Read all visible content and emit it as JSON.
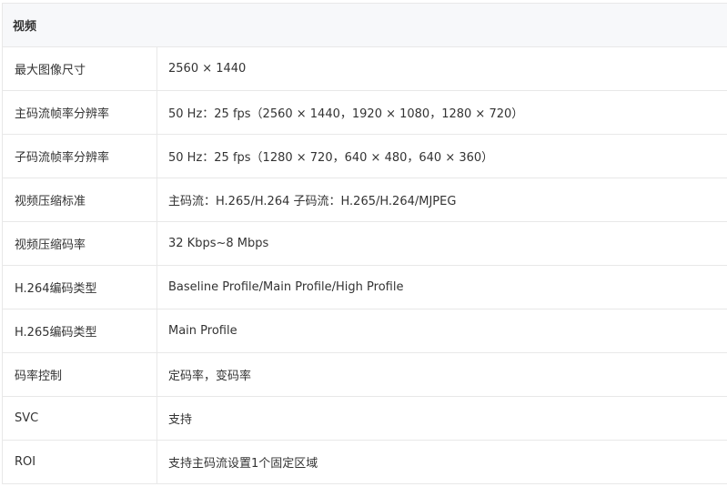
{
  "section": {
    "title": "视频"
  },
  "rows": [
    {
      "label": "最大图像尺寸",
      "value": "2560 × 1440"
    },
    {
      "label": "主码流帧率分辨率",
      "value": "50 Hz：25 fps（2560 × 1440，1920 × 1080，1280 × 720）"
    },
    {
      "label": "子码流帧率分辨率",
      "value": "50 Hz：25 fps（1280 × 720，640 × 480，640 × 360）"
    },
    {
      "label": "视频压缩标准",
      "value": "主码流：H.265/H.264 子码流：H.265/H.264/MJPEG"
    },
    {
      "label": "视频压缩码率",
      "value": "32 Kbps~8 Mbps"
    },
    {
      "label": "H.264编码类型",
      "value": "Baseline Profile/Main Profile/High Profile"
    },
    {
      "label": "H.265编码类型",
      "value": "Main Profile"
    },
    {
      "label": "码率控制",
      "value": "定码率，变码率"
    },
    {
      "label": "SVC",
      "value": "支持"
    },
    {
      "label": "ROI",
      "value": "支持主码流设置1个固定区域"
    }
  ]
}
